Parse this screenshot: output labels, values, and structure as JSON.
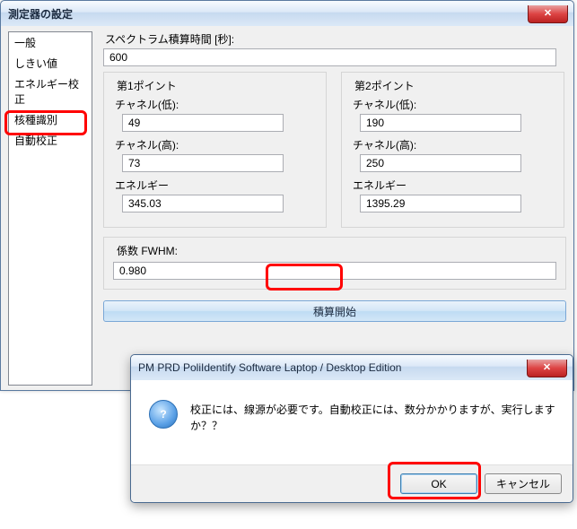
{
  "window": {
    "title": "測定器の設定"
  },
  "sidebar": {
    "items": [
      {
        "label": "一般"
      },
      {
        "label": "しきい値"
      },
      {
        "label": "エネルギー校正"
      },
      {
        "label": "核種識別"
      },
      {
        "label": "自動校正"
      }
    ],
    "selected_index": 4
  },
  "content": {
    "spectrum_time_label": "スペクトラム積算時間 [秒]:",
    "spectrum_time_value": "600",
    "point1": {
      "legend": "第1ポイント",
      "ch_low_label": "チャネル(低):",
      "ch_low_value": "49",
      "ch_high_label": "チャネル(高):",
      "ch_high_value": "73",
      "energy_label": "エネルギー",
      "energy_value": "345.03"
    },
    "point2": {
      "legend": "第2ポイント",
      "ch_low_label": "チャネル(低):",
      "ch_low_value": "190",
      "ch_high_label": "チャネル(高):",
      "ch_high_value": "250",
      "energy_label": "エネルギー",
      "energy_value": "1395.29"
    },
    "coef_label": "係数 FWHM:",
    "coef_value": "0.980",
    "start_button": "積算開始"
  },
  "dialog": {
    "title": "PM PRD PoliIdentify Software Laptop / Desktop Edition",
    "icon_glyph": "?",
    "message": "校正には、線源が必要です。自動校正には、数分かかりますが、実行しますか？？",
    "ok": "OK",
    "cancel": "キャンセル"
  }
}
